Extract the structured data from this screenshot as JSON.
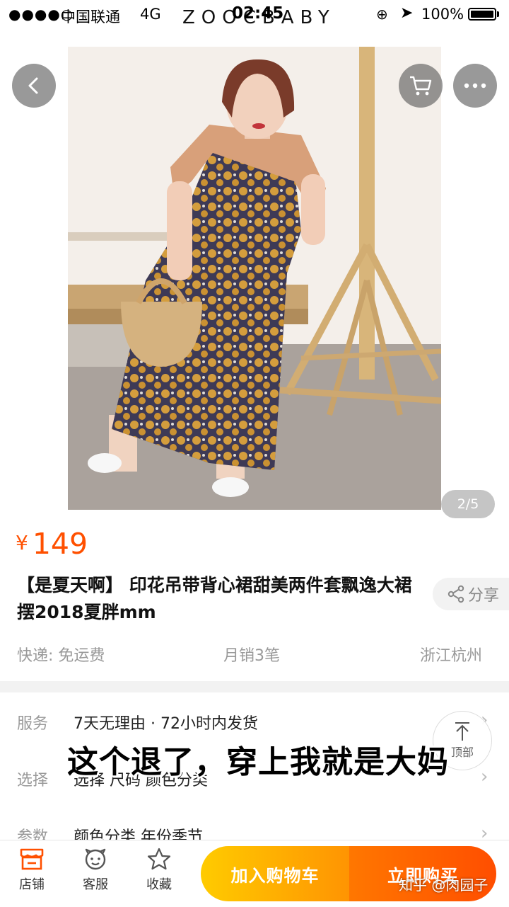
{
  "status_bar": {
    "signal": "●●●●○",
    "carrier": "中国联通",
    "network": "4G",
    "brand_overlay": "ZOOCBABY",
    "time": "02:45",
    "lock_glyph": "⊕",
    "location_glyph": "➤",
    "battery": "100%"
  },
  "nav": {
    "back_icon": "chevron-left-icon",
    "cart_icon": "shopping-cart-icon",
    "more_icon": "more-dots-icon"
  },
  "gallery": {
    "page_indicator": "2/5"
  },
  "product": {
    "currency": "¥",
    "price": "149",
    "title": "【是夏天啊】 印花吊带背心裙甜美两件套飘逸大裙摆2018夏胖mm",
    "share_label": "分享",
    "shipping": "快递: 免运费",
    "monthly_sales": "月销3笔",
    "location": "浙江杭州"
  },
  "options": {
    "rows": [
      {
        "label": "服务",
        "value": "7天无理由 · 72小时内发货"
      },
      {
        "label": "选择",
        "value": "选择 尺码 颜色分类"
      },
      {
        "label": "参数",
        "value": "颜色分类 年份季节"
      }
    ],
    "top_button_label": "顶部"
  },
  "caption": "这个退了，穿上我就是大妈",
  "bottom_bar": {
    "store_label": "店铺",
    "service_label": "客服",
    "favorite_label": "收藏",
    "add_to_cart_label": "加入购物车",
    "buy_now_label": "立即购买"
  },
  "watermark": "知乎 @肉园子",
  "colors": {
    "price": "#ff5000",
    "cart_gradient": [
      "#ffcb00",
      "#ff9402"
    ],
    "buy_gradient": [
      "#ff7700",
      "#ff4e00"
    ]
  }
}
